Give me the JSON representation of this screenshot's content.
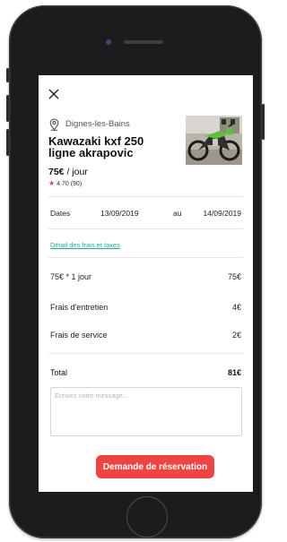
{
  "listing": {
    "location": "Dignes-les-Bains",
    "title": "Kawazaki kxf 250 ligne akrapovic",
    "price_amount": "75€",
    "price_unit": " / jour",
    "rating": "4.70",
    "rating_count": "(90)"
  },
  "dates": {
    "label": "Dates",
    "start": "13/09/2019",
    "separator": "au",
    "end": "14/09/2019"
  },
  "fees": {
    "detail_link": "Détail des frais et taxes",
    "lines": [
      {
        "label": "75€ * 1 jour",
        "amount": "75€"
      },
      {
        "label": "Frais d'entretien",
        "amount": "4€"
      },
      {
        "label": "Frais de service",
        "amount": "2€"
      }
    ],
    "total_label": "Total",
    "total_amount": "81€"
  },
  "message": {
    "placeholder": "Ecrivez votre message..."
  },
  "cta": {
    "label": "Demande de réservation"
  },
  "icons": {
    "close": "close-icon",
    "location": "location-pin-icon",
    "star": "star-icon"
  },
  "colors": {
    "accent": "#ef4444",
    "link": "#2aa79b",
    "star": "#e0423a"
  }
}
